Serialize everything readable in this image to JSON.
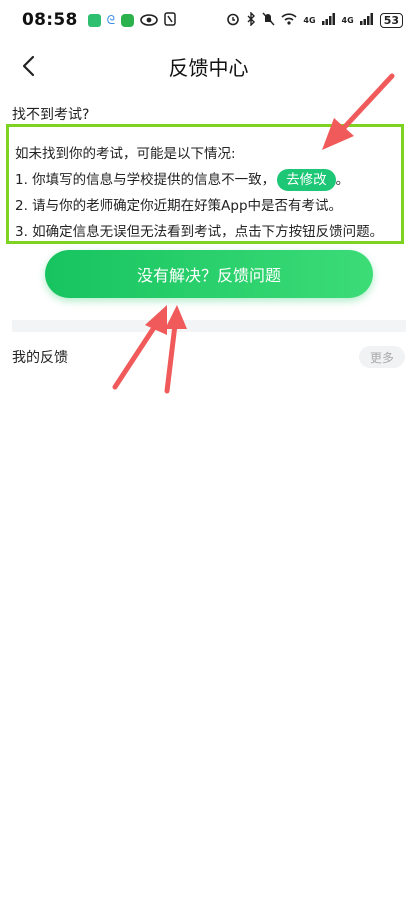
{
  "status_bar": {
    "time": "08:58",
    "network": "4G",
    "network2": "4G",
    "battery": "53"
  },
  "nav": {
    "title": "反馈中心"
  },
  "main": {
    "question": "找不到考试?",
    "intro": "如未找到你的考试，可能是以下情况:",
    "item1": "1. 你填写的信息与学校提供的信息不一致，",
    "item1_suffix": "。",
    "modify_label": "去修改",
    "item2": "2. 请与你的老师确定你近期在好策App中是否有考试。",
    "item3": "3. 如确定信息无误但无法看到考试，点击下方按钮反馈问题。",
    "feedback_button": "没有解决？反馈问题"
  },
  "my_feedback": {
    "title": "我的反馈",
    "more": "更多"
  },
  "colors": {
    "primary_green": "#1ec776",
    "highlight_border": "#7ed321",
    "annotation_arrow": "#f05a5a"
  }
}
